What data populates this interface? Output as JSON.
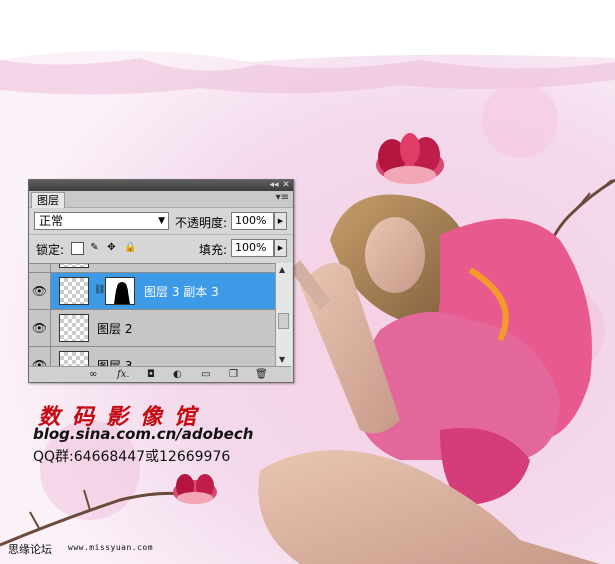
{
  "panel": {
    "tab_label": "图层",
    "blend_mode": "正常",
    "opacity_label": "不透明度:",
    "opacity_value": "100%",
    "lock_label": "锁定:",
    "fill_label": "填充:",
    "fill_value": "100%",
    "layers": [
      {
        "name": "图层 3 副本 3",
        "selected": true,
        "has_mask": true
      },
      {
        "name": "图层 2",
        "selected": false,
        "has_mask": false
      },
      {
        "name": "图层 3",
        "selected": false,
        "has_mask": false
      }
    ],
    "bottom_icons": [
      "link-icon",
      "fx-icon",
      "add-mask-icon",
      "adjustment-layer-icon",
      "group-folder-icon",
      "new-layer-icon",
      "trash-icon"
    ]
  },
  "overlay": {
    "title": "数码影像馆",
    "blog": "blog.sina.com.cn/adobech",
    "qq": "QQ群:64668447或12669976"
  },
  "watermark": {
    "forum": "思缘论坛",
    "site": "www.missyuan.com"
  },
  "colors": {
    "selection": "#3c9ae6",
    "title_red": "#c6090f",
    "pink": "#e0588a"
  }
}
